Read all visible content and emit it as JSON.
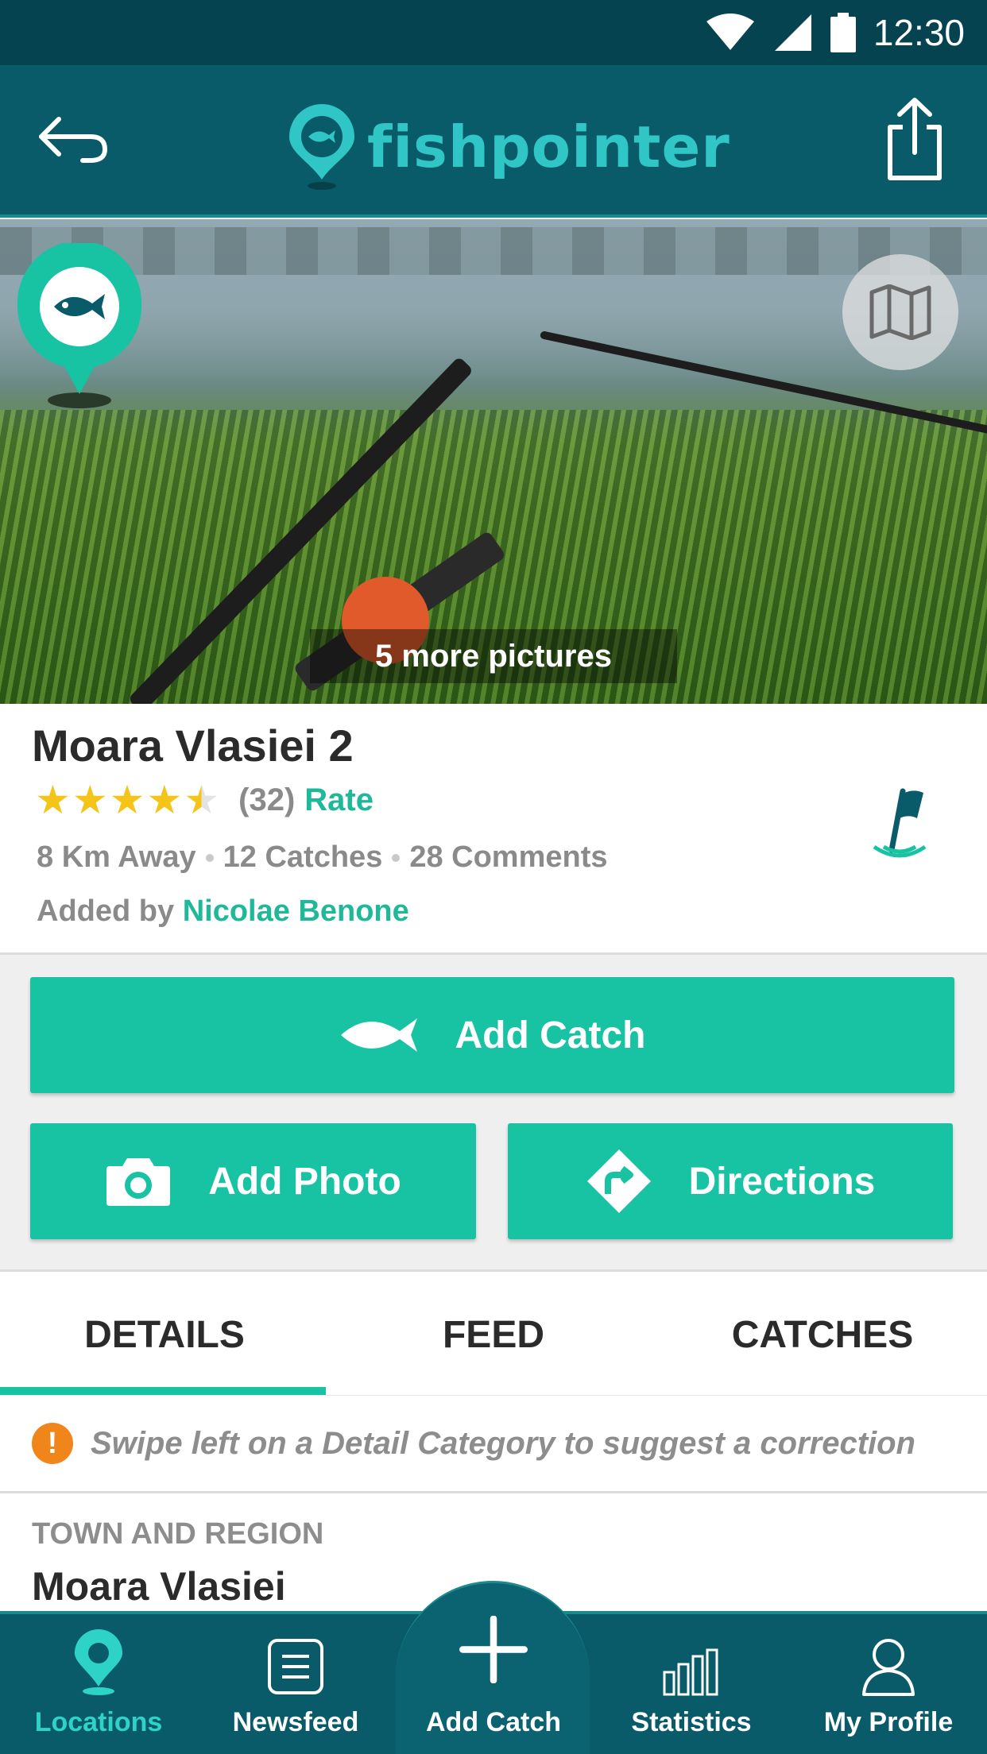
{
  "status_bar": {
    "time": "12:30"
  },
  "app_bar": {
    "logo_text": "fishpointer"
  },
  "hero": {
    "more_pictures": "5 more pictures"
  },
  "location": {
    "title": "Moara Vlasiei 2",
    "rating": 4.5,
    "rating_count": "(32)",
    "rate_label": "Rate",
    "distance": "8 Km Away",
    "catches": "12 Catches",
    "comments": "28 Comments",
    "added_by_label": "Added by",
    "author": "Nicolae Benone"
  },
  "actions": {
    "add_catch": "Add Catch",
    "add_photo": "Add Photo",
    "directions": "Directions"
  },
  "tabs": [
    {
      "label": "DETAILS",
      "active": true
    },
    {
      "label": "FEED",
      "active": false
    },
    {
      "label": "CATCHES",
      "active": false
    }
  ],
  "hint": {
    "text": "Swipe left on a Detail Category to suggest a correction"
  },
  "details": {
    "label": "TOWN AND REGION",
    "value": "Moara Vlasiei"
  },
  "bottom_nav": [
    {
      "label": "Locations",
      "icon": "location-pin-icon",
      "active": true
    },
    {
      "label": "Newsfeed",
      "icon": "newsfeed-icon",
      "active": false
    },
    {
      "label": "Add Catch",
      "icon": "plus-icon",
      "active": false
    },
    {
      "label": "Statistics",
      "icon": "bar-chart-icon",
      "active": false
    },
    {
      "label": "My Profile",
      "icon": "user-icon",
      "active": false
    }
  ],
  "colors": {
    "primary_dark": "#0a5b69",
    "status_bar": "#04434f",
    "accent": "#17c3a2",
    "logo": "#30c6c6",
    "star": "#f4c518",
    "warning": "#f0851a"
  }
}
